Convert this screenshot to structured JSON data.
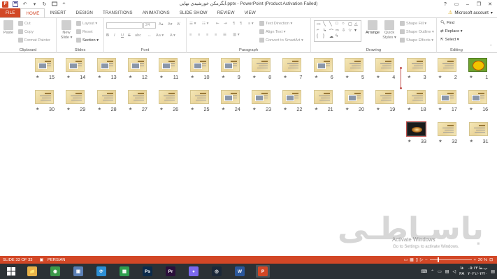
{
  "window": {
    "title": "آبگرمکن خورشیدی نهایی.pptx - PowerPoint (Product Activation Failed)",
    "help": "?",
    "minimize": "–",
    "restore": "❐",
    "close": "✕"
  },
  "qat": {
    "app_icon": "P",
    "save_icon": "floppy-icon",
    "undo_icon": "undo-icon",
    "redo_icon": "redo-icon"
  },
  "tabs": [
    "FILE",
    "HOME",
    "INSERT",
    "DESIGN",
    "TRANSITIONS",
    "ANIMATIONS",
    "SLIDE SHOW",
    "REVIEW",
    "VIEW"
  ],
  "active_tab": "HOME",
  "account": {
    "label": "Microsoft account",
    "caret": "▾"
  },
  "ribbon": {
    "clipboard": {
      "label": "Clipboard",
      "paste": "Paste",
      "cut": "Cut",
      "copy": "Copy",
      "format_painter": "Format Painter"
    },
    "slides": {
      "label": "Slides",
      "new_slide_1": "New",
      "new_slide_2": "Slide ▾",
      "layout": "Layout ▾",
      "reset": "Reset",
      "section": "Section ▾"
    },
    "font": {
      "label": "Font",
      "size": "24",
      "bold": "B",
      "italic": "I",
      "underline": "U",
      "strike": "S",
      "shadow": "abc",
      "grow": "A▴",
      "shrink": "A▾",
      "clear": "A̸",
      "case": "Aa ▾",
      "color": "A ▾"
    },
    "paragraph": {
      "label": "Paragraph",
      "text_direction": "Text Direction ▾",
      "align_text": "Align Text ▾",
      "smartart": "Convert to SmartArt ▾"
    },
    "drawing": {
      "label": "Drawing",
      "arrange": "Arrange",
      "quick_styles_1": "Quick",
      "quick_styles_2": "Styles ▾",
      "shape_fill": "Shape Fill ▾",
      "shape_outline": "Shape Outline ▾",
      "shape_effects": "Shape Effects ▾"
    },
    "editing": {
      "label": "Editing",
      "find": "Find",
      "replace": "Replace ▾",
      "select": "Select ▾"
    }
  },
  "slides": [
    {
      "n": "15",
      "style": "pic"
    },
    {
      "n": "14",
      "style": "pic"
    },
    {
      "n": "13",
      "style": "pic"
    },
    {
      "n": "12",
      "style": "pic"
    },
    {
      "n": "11",
      "style": "pic"
    },
    {
      "n": "10",
      "style": "pic"
    },
    {
      "n": "9",
      "style": "pic"
    },
    {
      "n": "8",
      "style": "text"
    },
    {
      "n": "7",
      "style": "text"
    },
    {
      "n": "6",
      "style": "pic"
    },
    {
      "n": "5",
      "style": "text"
    },
    {
      "n": "4",
      "style": "text"
    },
    {
      "n": "3",
      "style": "text"
    },
    {
      "n": "2",
      "style": "text"
    },
    {
      "n": "1",
      "style": "green"
    },
    {
      "n": "30",
      "style": "text"
    },
    {
      "n": "29",
      "style": "text"
    },
    {
      "n": "28",
      "style": "text"
    },
    {
      "n": "27",
      "style": "text"
    },
    {
      "n": "26",
      "style": "text"
    },
    {
      "n": "25",
      "style": "text"
    },
    {
      "n": "24",
      "style": "pic"
    },
    {
      "n": "23",
      "style": "pic"
    },
    {
      "n": "22",
      "style": "pic"
    },
    {
      "n": "21",
      "style": "text"
    },
    {
      "n": "20",
      "style": "pic"
    },
    {
      "n": "19",
      "style": "text"
    },
    {
      "n": "18",
      "style": "text"
    },
    {
      "n": "17",
      "style": "pic"
    },
    {
      "n": "16",
      "style": "pic"
    },
    {
      "n": "33",
      "style": "dark"
    },
    {
      "n": "32",
      "style": "text"
    },
    {
      "n": "31",
      "style": "text"
    }
  ],
  "star": "★",
  "watermark": {
    "logo": "باسـاطـی",
    "activation_title": "Activate Windows",
    "activation_sub": "Go to Settings to activate Windows."
  },
  "status": {
    "slide": "SLIDE 33 OF 33",
    "language": "PERSIAN",
    "zoom": "20 %",
    "zoom_level": 0.2
  },
  "taskbar": {
    "apps": [
      {
        "name": "explorer",
        "label": "📁",
        "color": "#e8b34a"
      },
      {
        "name": "chrome",
        "label": "◉",
        "color": "#3c9a4a"
      },
      {
        "name": "files",
        "label": "▣",
        "color": "#5a7fb5"
      },
      {
        "name": "refresh",
        "label": "⟳",
        "color": "#2d8fd4"
      },
      {
        "name": "calculator",
        "label": "▦",
        "color": "#2f9e4f"
      },
      {
        "name": "photoshop",
        "label": "Ps",
        "color": "#0b2a4a"
      },
      {
        "name": "premiere",
        "label": "Pr",
        "color": "#2a0f3a"
      },
      {
        "name": "messenger",
        "label": "●",
        "color": "#7b68ee"
      },
      {
        "name": "steam",
        "label": "◎",
        "color": "#1b2838"
      },
      {
        "name": "word",
        "label": "W",
        "color": "#2b579a"
      },
      {
        "name": "powerpoint",
        "label": "P",
        "color": "#d24726"
      }
    ],
    "lang_1": "فا",
    "lang_2": "FA",
    "time": "۰۵:۱۳ ب.ظ",
    "date": "۲۰۲۱/۰۲/۲۰"
  }
}
